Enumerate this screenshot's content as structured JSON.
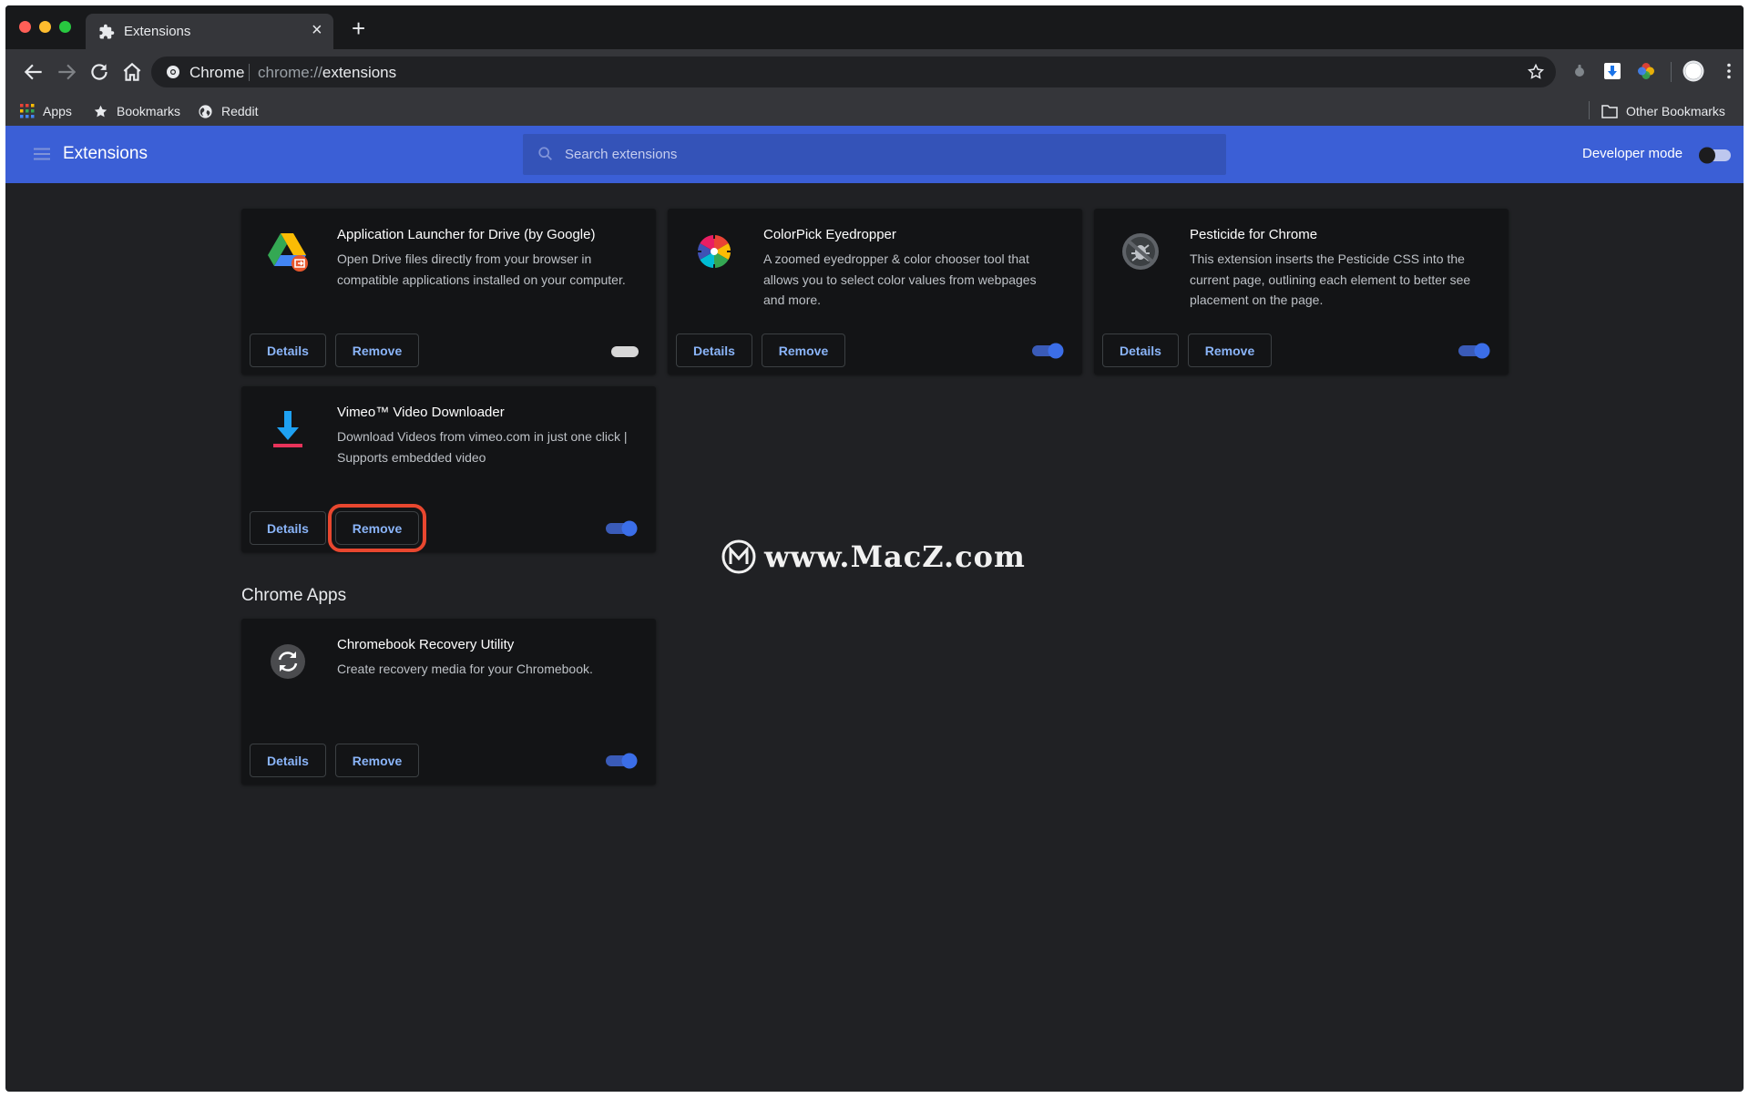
{
  "window": {
    "tab": {
      "title": "Extensions",
      "close_label": "×"
    },
    "new_tab_label": "+"
  },
  "toolbar": {
    "omnibox": {
      "chip_label": "Chrome",
      "url_prefix": "chrome://",
      "url_host": "extensions"
    }
  },
  "bookmarks": {
    "items": [
      {
        "label": "Apps",
        "icon": "apps-grid-icon"
      },
      {
        "label": "Bookmarks",
        "icon": "star-icon"
      },
      {
        "label": "Reddit",
        "icon": "globe-icon"
      }
    ],
    "other_label": "Other Bookmarks"
  },
  "header": {
    "title": "Extensions",
    "search_placeholder": "Search extensions",
    "developer_mode_label": "Developer mode",
    "developer_mode_on": false
  },
  "extensions": [
    {
      "name": "Application Launcher for Drive (by Google)",
      "description": "Open Drive files directly from your browser in compatible applications installed on your computer.",
      "details_label": "Details",
      "remove_label": "Remove",
      "enabled": false
    },
    {
      "name": "ColorPick Eyedropper",
      "description": "A zoomed eyedropper & color chooser tool that allows you to select color values from webpages and more.",
      "details_label": "Details",
      "remove_label": "Remove",
      "enabled": true
    },
    {
      "name": "Pesticide for Chrome",
      "description": "This extension inserts the Pesticide CSS into the current page, outlining each element to better see placement on the page.",
      "details_label": "Details",
      "remove_label": "Remove",
      "enabled": true
    },
    {
      "name": "Vimeo™ Video Downloader",
      "description": "Download Videos from vimeo.com in just one click | Supports embedded video",
      "details_label": "Details",
      "remove_label": "Remove",
      "enabled": true,
      "remove_highlighted": true
    }
  ],
  "chrome_apps": {
    "section_title": "Chrome Apps",
    "items": [
      {
        "name": "Chromebook Recovery Utility",
        "description": "Create recovery media for your Chromebook.",
        "details_label": "Details",
        "remove_label": "Remove",
        "enabled": true
      }
    ]
  },
  "watermark": {
    "text": "www.MacZ.com"
  },
  "colors": {
    "header_blue": "#3b5fd6",
    "toggle_on": "#3b6ee8",
    "link_blue": "#8ab4f8",
    "highlight_red": "#e8472f"
  }
}
